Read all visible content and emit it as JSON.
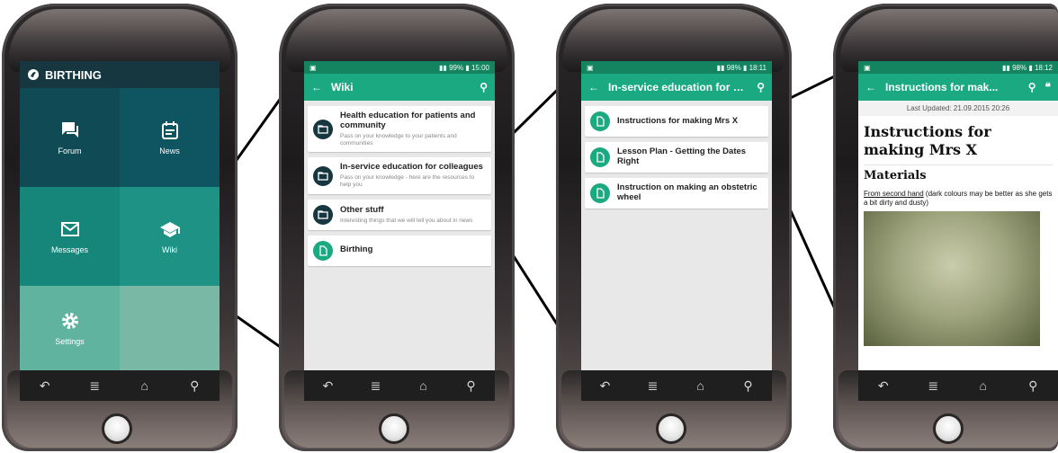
{
  "colors": {
    "dark_teal": "#16373f",
    "teal": "#1aa981",
    "status_green": "#13845f",
    "tile1": "#0f4a55",
    "tile2": "#0e5461",
    "tile3": "#17867a",
    "tile4": "#1e9385",
    "tile5": "#5fb39f",
    "tile6": "#7ab8a6"
  },
  "home": {
    "app_title": "BIRTHING",
    "tiles": [
      {
        "label": "Forum",
        "icon": "forum-icon"
      },
      {
        "label": "News",
        "icon": "news-icon"
      },
      {
        "label": "Messages",
        "icon": "messages-icon"
      },
      {
        "label": "Wiki",
        "icon": "wiki-icon"
      },
      {
        "label": "Settings",
        "icon": "settings-icon"
      },
      {
        "label": "",
        "icon": ""
      }
    ]
  },
  "wiki": {
    "status_time": "15:00",
    "status_battery": "99%",
    "title": "Wiki",
    "items": [
      {
        "title": "Health education for patients and community",
        "desc": "Pass on your knowledge to your patients and communities",
        "icon": "folder-icon"
      },
      {
        "title": "In-service education for colleagues",
        "desc": "Pass on your knowledge - here are the resources to help you",
        "icon": "folder-icon"
      },
      {
        "title": "Other stuff",
        "desc": "Interesting things that we will tell you about in news",
        "icon": "folder-icon"
      },
      {
        "title": "Birthing",
        "desc": "",
        "icon": "document-icon"
      }
    ]
  },
  "inservice": {
    "status_time": "18:11",
    "status_battery": "98%",
    "title": "In-service education for c...",
    "items": [
      {
        "title": "Instructions for making Mrs X"
      },
      {
        "title": "Lesson Plan - Getting the Dates Right"
      },
      {
        "title": "Instruction on making an obstetric wheel"
      }
    ]
  },
  "article": {
    "status_time": "18:12",
    "status_battery": "98%",
    "title": "Instructions for mak...",
    "updated": "Last Updated: 21.09.2015 20:26",
    "heading": "Instructions for making Mrs X",
    "subheading": "Materials",
    "link_text": "From second hand",
    "body_text": " (dark colours may be better as she gets a bit dirty and dusty)"
  }
}
